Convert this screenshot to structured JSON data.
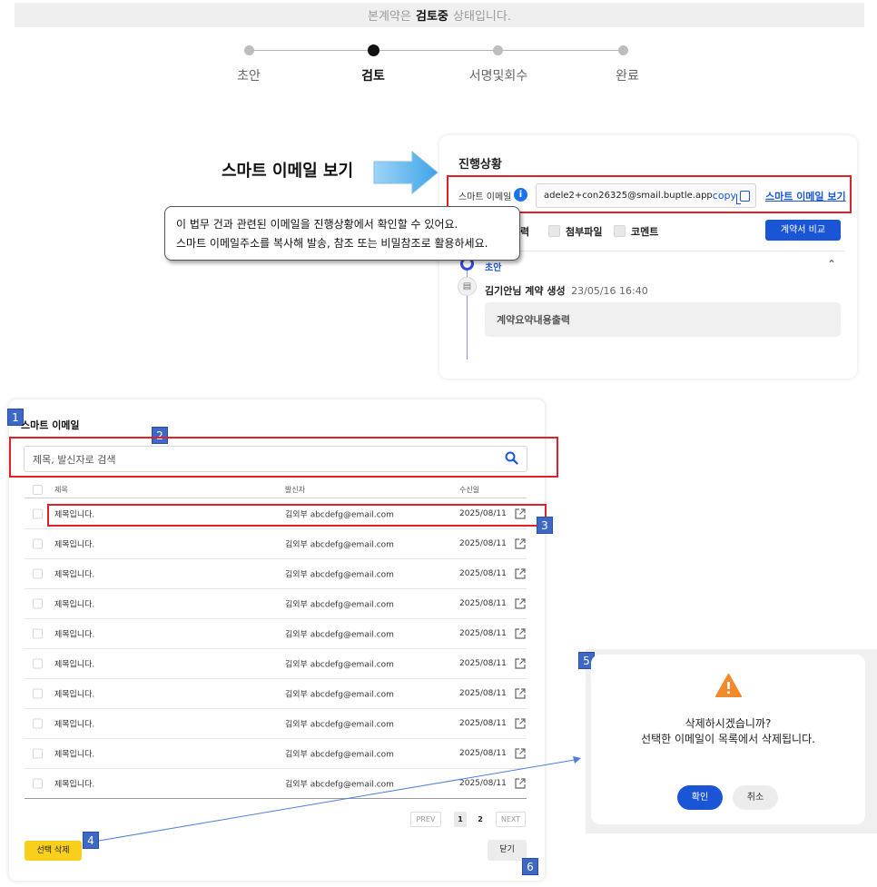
{
  "status_banner": {
    "prefix": "본계약은",
    "highlight": "검토중",
    "suffix": "상태입니다."
  },
  "stepper": {
    "steps": [
      {
        "label": "초안",
        "active": false
      },
      {
        "label": "검토",
        "active": true
      },
      {
        "label": "서명및회수",
        "active": false
      },
      {
        "label": "완료",
        "active": false
      }
    ]
  },
  "callout": {
    "title": "스마트 이메일 보기",
    "tooltip_line1": "이 법무 건과 관련된 이메일을 진행상황에서 확인할 수 있어요.",
    "tooltip_line2": "스마트 이메일주소를 복사해 발송, 참조 또는 비밀참조로 활용하세요."
  },
  "progress_panel": {
    "title": "진행상황",
    "email_label": "스마트 이메일",
    "email_value": "adele2+con26325@smail.buptle.app",
    "copy_label": "copy",
    "view_link": "스마트 이메일 보기",
    "filters": [
      {
        "label": "첨부파일"
      },
      {
        "label": "코멘트"
      }
    ],
    "filter_partial": "력",
    "compare_button": "계약서 비교",
    "stage_label": "초안",
    "event_text": "김기안님 계약 생성",
    "event_time": "23/05/16 16:40",
    "memo": "계약요약내용출력"
  },
  "email_modal": {
    "title": "스마트 이메일",
    "search_placeholder": "제목, 발신자로 검색",
    "columns": {
      "subject": "제목",
      "sender": "발신자",
      "date": "수신일"
    },
    "rows": [
      {
        "subject": "제목입니다.",
        "sender": "김외부 abcdefg@email.com",
        "date": "2025/08/11"
      },
      {
        "subject": "제목입니다.",
        "sender": "김외부 abcdefg@email.com",
        "date": "2025/08/11"
      },
      {
        "subject": "제목입니다.",
        "sender": "김외부 abcdefg@email.com",
        "date": "2025/08/11"
      },
      {
        "subject": "제목입니다.",
        "sender": "김외부 abcdefg@email.com",
        "date": "2025/08/11"
      },
      {
        "subject": "제목입니다.",
        "sender": "김외부 abcdefg@email.com",
        "date": "2025/08/11"
      },
      {
        "subject": "제목입니다.",
        "sender": "김외부 abcdefg@email.com",
        "date": "2025/08/11"
      },
      {
        "subject": "제목입니다.",
        "sender": "김외부 abcdefg@email.com",
        "date": "2025/08/11"
      },
      {
        "subject": "제목입니다.",
        "sender": "김외부 abcdefg@email.com",
        "date": "2025/08/11"
      },
      {
        "subject": "제목입니다.",
        "sender": "김외부 abcdefg@email.com",
        "date": "2025/08/11"
      },
      {
        "subject": "제목입니다.",
        "sender": "김외부 abcdefg@email.com",
        "date": "2025/08/11"
      }
    ],
    "pagination": {
      "prev": "PREV",
      "pages": [
        "1",
        "2"
      ],
      "current": "1",
      "next": "NEXT"
    },
    "delete_button": "선택 삭제",
    "close_button": "닫기"
  },
  "confirm_dialog": {
    "line1": "삭제하시겠습니까?",
    "line2": "선택한 이메일이 목록에서 삭제됩니다.",
    "ok_button": "확인",
    "cancel_button": "취소"
  },
  "annotations": [
    "1",
    "2",
    "3",
    "4",
    "5",
    "6"
  ],
  "colors": {
    "primary_blue": "#1a55d6",
    "highlight_red": "#e0202a",
    "badge_blue": "#3e68c7",
    "delete_yellow": "#f8cf1c",
    "warning_orange": "#f08a2c",
    "arrow_blue": "#3fa4e8"
  }
}
